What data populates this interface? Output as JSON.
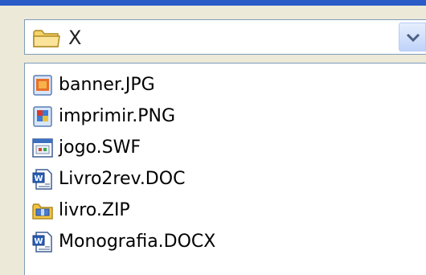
{
  "location": {
    "value": "X",
    "icon": "folder-icon"
  },
  "files": [
    {
      "name": "banner.JPG",
      "icon": "jpg-image-icon"
    },
    {
      "name": "imprimir.PNG",
      "icon": "png-image-icon"
    },
    {
      "name": "jogo.SWF",
      "icon": "swf-file-icon"
    },
    {
      "name": "Livro2rev.DOC",
      "icon": "word-doc-icon"
    },
    {
      "name": "livro.ZIP",
      "icon": "zip-archive-icon"
    },
    {
      "name": "Monografia.DOCX",
      "icon": "word-docx-icon"
    }
  ],
  "colors": {
    "accent": "#2A5CC7",
    "border": "#7F9DB9",
    "background": "#ECE9D8"
  }
}
